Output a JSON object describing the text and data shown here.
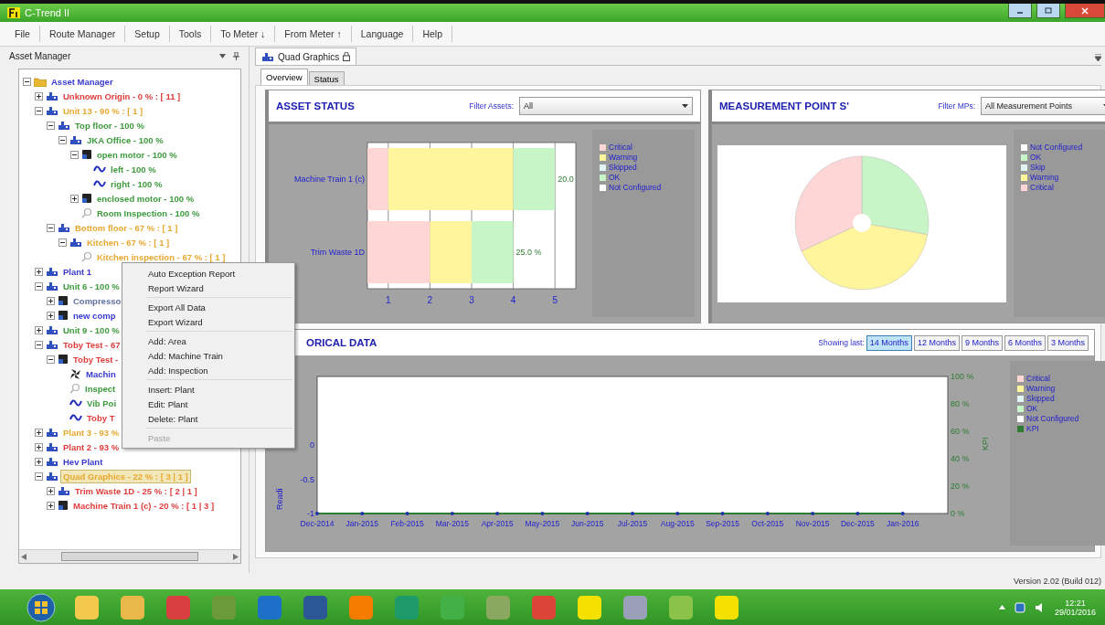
{
  "window": {
    "title": "C-Trend II"
  },
  "menu": [
    "File",
    "Route Manager",
    "Setup",
    "Tools",
    "To Meter ↓",
    "From Meter ↑",
    "Language",
    "Help"
  ],
  "asset_panel": {
    "title": "Asset Manager"
  },
  "tree": {
    "items": [
      {
        "label": "Asset Manager",
        "kind": "folder",
        "color": "#3a3ad0",
        "selected": false,
        "expanded": true,
        "children": [
          {
            "label": "Unknown Origin - 0 % : [ 11 ]",
            "kind": "area",
            "color": "#e03c3c",
            "selected": false,
            "expanded": false
          },
          {
            "label": "Unit 13 - 90 % : [ 1 ]",
            "kind": "area",
            "color": "#e8a830",
            "selected": false,
            "expanded": true,
            "children": [
              {
                "label": "Top floor - 100 %",
                "kind": "area",
                "color": "#3c9a3c",
                "selected": false,
                "expanded": true,
                "children": [
                  {
                    "label": "JKA Office - 100 %",
                    "kind": "area",
                    "color": "#3c9a3c",
                    "selected": false,
                    "expanded": true,
                    "children": [
                      {
                        "label": "open motor - 100 %",
                        "kind": "machine",
                        "color": "#3c9a3c",
                        "selected": false,
                        "expanded": true,
                        "children": [
                          {
                            "label": "left - 100 %",
                            "kind": "point",
                            "color": "#3c9a3c",
                            "selected": false
                          },
                          {
                            "label": "right - 100 %",
                            "kind": "point",
                            "color": "#3c9a3c",
                            "selected": false
                          }
                        ]
                      },
                      {
                        "label": "enclosed motor - 100 %",
                        "kind": "machine",
                        "color": "#3c9a3c",
                        "selected": false,
                        "expanded": false
                      },
                      {
                        "label": "Room Inspection - 100 %",
                        "kind": "inspection",
                        "color": "#3c9a3c",
                        "selected": false
                      }
                    ]
                  }
                ]
              },
              {
                "label": "Bottom floor - 67 % : [ 1 ]",
                "kind": "area",
                "color": "#e8a830",
                "selected": false,
                "expanded": true,
                "children": [
                  {
                    "label": "Kitchen - 67 % : [ 1 ]",
                    "kind": "area",
                    "color": "#e8a830",
                    "selected": false,
                    "expanded": true,
                    "children": [
                      {
                        "label": "Kitchen inspection - 67 % : [ 1 ]",
                        "kind": "inspection",
                        "color": "#e8a830",
                        "selected": false
                      }
                    ]
                  }
                ]
              }
            ]
          },
          {
            "label": "Plant 1",
            "kind": "area",
            "color": "#3a3ad0",
            "selected": false,
            "expanded": false
          },
          {
            "label": "Unit 6 - 100 %",
            "kind": "area",
            "color": "#3c9a3c",
            "selected": false,
            "expanded": true,
            "children": [
              {
                "label": "Compresso",
                "kind": "machine",
                "color": "#6070a0",
                "selected": false,
                "expanded": false
              },
              {
                "label": "new comp",
                "kind": "machine",
                "color": "#3a3ad0",
                "selected": false,
                "expanded": false
              }
            ]
          },
          {
            "label": "Unit 9 - 100 %",
            "kind": "area",
            "color": "#3c9a3c",
            "selected": false,
            "expanded": false
          },
          {
            "label": "Toby Test - 67",
            "kind": "area",
            "color": "#e03c3c",
            "selected": false,
            "expanded": true,
            "children": [
              {
                "label": "Toby Test -",
                "kind": "machine",
                "color": "#e03c3c",
                "selected": false,
                "expanded": true,
                "children": [
                  {
                    "label": "Machin",
                    "kind": "fan",
                    "color": "#3a3ad0",
                    "selected": false
                  },
                  {
                    "label": "Inspect",
                    "kind": "inspection",
                    "color": "#3c9a3c",
                    "selected": false
                  },
                  {
                    "label": "Vib Poi",
                    "kind": "point",
                    "color": "#3c9a3c",
                    "selected": false
                  },
                  {
                    "label": "Toby T",
                    "kind": "point",
                    "color": "#e03c3c",
                    "selected": false
                  }
                ]
              }
            ]
          },
          {
            "label": "Plant 3 - 93 %",
            "kind": "area",
            "color": "#e8a830",
            "selected": false,
            "expanded": false
          },
          {
            "label": "Plant 2 - 93 %",
            "kind": "area",
            "color": "#e03c3c",
            "selected": false,
            "expanded": false
          },
          {
            "label": "Hev Plant",
            "kind": "area",
            "color": "#3a3ad0",
            "selected": false,
            "expanded": false
          },
          {
            "label": "Quad Graphics - 22 % : [ 3 | 1 ]",
            "kind": "area",
            "color": "#e8a830",
            "selected": true,
            "expanded": true,
            "children": [
              {
                "label": "Trim Waste 1D - 25 % : [ 2 | 1 ]",
                "kind": "area",
                "color": "#e03c3c",
                "selected": false,
                "expanded": false
              },
              {
                "label": "Machine Train 1 (c) - 20 % : [ 1 | 3 ]",
                "kind": "machine",
                "color": "#e03c3c",
                "selected": false,
                "expanded": false
              }
            ]
          }
        ]
      }
    ]
  },
  "context_menu": {
    "groups": [
      [
        {
          "label": "Auto Exception Report",
          "disabled": false
        },
        {
          "label": "Report Wizard",
          "disabled": false
        }
      ],
      [
        {
          "label": "Export All Data",
          "disabled": false
        },
        {
          "label": "Export Wizard",
          "disabled": false
        }
      ],
      [
        {
          "label": "Add: Area",
          "disabled": false
        },
        {
          "label": "Add: Machine Train",
          "disabled": false
        },
        {
          "label": "Add: Inspection",
          "disabled": false
        }
      ],
      [
        {
          "label": "Insert: Plant",
          "disabled": false
        },
        {
          "label": "Edit: Plant",
          "disabled": false
        },
        {
          "label": "Delete: Plant",
          "disabled": false
        }
      ],
      [
        {
          "label": "Paste",
          "disabled": true
        }
      ]
    ]
  },
  "document_tab": {
    "label": "Quad Graphics"
  },
  "tabs": [
    {
      "label": "Overview",
      "selected": true
    },
    {
      "label": "Status",
      "selected": false
    }
  ],
  "asset_status": {
    "title": "ASSET STATUS",
    "filter_label": "Filter Assets:",
    "filter_value": "All",
    "chart_data": {
      "type": "bar",
      "orientation": "horizontal",
      "stacked": true,
      "grid": true,
      "categories": [
        "Machine Train 1 (c)",
        "Trim Waste 1D"
      ],
      "xlim": [
        0.5,
        5.5
      ],
      "xticks": [
        1,
        2,
        3,
        4,
        5
      ],
      "series": [
        {
          "name": "Critical",
          "color": "#ffd6d6",
          "values": [
            1,
            2
          ]
        },
        {
          "name": "Warning",
          "color": "#fff59d",
          "values": [
            3,
            1
          ]
        },
        {
          "name": "Skipped",
          "color": "#e0f4f4",
          "values": [
            null,
            null
          ]
        },
        {
          "name": "OK",
          "color": "#c8f5c8",
          "values": [
            1,
            1
          ]
        },
        {
          "name": "Not Configured",
          "color": "#ffffff",
          "values": [
            null,
            null
          ]
        }
      ],
      "value_labels": [
        "20.0",
        "25.0 %"
      ]
    }
  },
  "measurement_points": {
    "title": "MEASUREMENT POINT S'",
    "filter_label": "Filter MPs:",
    "filter_value": "All Measurement Points",
    "legend": [
      {
        "label": "Not Configured",
        "color": "#ffffff"
      },
      {
        "label": "OK",
        "color": "#c8f5c8"
      },
      {
        "label": "Skip",
        "color": "#e0f4f4"
      },
      {
        "label": "Warning",
        "color": "#fff59d"
      },
      {
        "label": "Critical",
        "color": "#ffd6d6"
      }
    ]
  },
  "historical": {
    "title": "ORICAL DATA",
    "showing_label": "Showing last:",
    "periods": [
      {
        "label": "14 Months",
        "selected": true
      },
      {
        "label": "12 Months",
        "selected": false
      },
      {
        "label": "9 Months",
        "selected": false
      },
      {
        "label": "6 Months",
        "selected": false
      },
      {
        "label": "3 Months",
        "selected": false
      }
    ],
    "legend": [
      {
        "label": "Critical",
        "color": "#ffd6d6"
      },
      {
        "label": "Warning",
        "color": "#fff59d"
      },
      {
        "label": "Skipped",
        "color": "#e0f4f4"
      },
      {
        "label": "OK",
        "color": "#c8f5c8"
      },
      {
        "label": "Not Configured",
        "color": "#ffffff"
      }
    ],
    "chart_data": {
      "type": "line",
      "ylabel": "Readi",
      "categories": [
        "Dec-2014",
        "Jan-2015",
        "Feb-2015",
        "Mar-2015",
        "Apr-2015",
        "May-2015",
        "Jun-2015",
        "Jul-2015",
        "Aug-2015",
        "Sep-2015",
        "Oct-2015",
        "Nov-2015",
        "Dec-2015",
        "Jan-2016"
      ],
      "ylim": [
        -1,
        1
      ],
      "yticks": [
        -1,
        -0.5,
        0
      ],
      "y2label": "KPI",
      "y2lim": [
        0,
        100
      ],
      "y2ticks": [
        {
          "value": 0,
          "label": "0 %"
        },
        {
          "value": 20,
          "label": "20 %"
        },
        {
          "value": 40,
          "label": "40 %"
        },
        {
          "value": 60,
          "label": "60 %"
        },
        {
          "value": 80,
          "label": "80 %"
        },
        {
          "value": 100,
          "label": "100 %"
        }
      ],
      "series": [
        {
          "name": "KPI",
          "color": "#2e7d32",
          "values": [
            -1,
            -1,
            -1,
            -1,
            -1,
            -1,
            -1,
            -1,
            -1,
            -1,
            -1,
            -1,
            -1,
            -1
          ]
        }
      ]
    }
  },
  "status_bar": {
    "version": "Version 2.02 (Build 012)"
  },
  "taskbar": {
    "apps": [
      {
        "color": "#f2c94c"
      },
      {
        "color": "#e8b84a"
      },
      {
        "color": "#d84040"
      },
      {
        "color": "#6a9a3a"
      },
      {
        "color": "#1e6fc8"
      },
      {
        "color": "#2b5797"
      },
      {
        "color": "#f57c00"
      },
      {
        "color": "#1e9a6a"
      },
      {
        "color": "#43b047"
      },
      {
        "color": "#8aa860"
      },
      {
        "color": "#db4437"
      },
      {
        "color": "#f5e100"
      },
      {
        "color": "#9aa0b8"
      },
      {
        "color": "#8bc34a"
      },
      {
        "color": "#f5e100"
      }
    ],
    "time": "12:21",
    "date": "29/01/2016"
  }
}
